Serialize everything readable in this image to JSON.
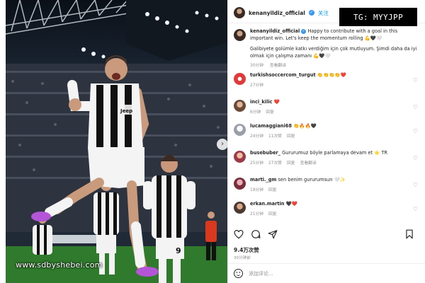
{
  "photo": {
    "watermark": "www.sdbyshebei.com",
    "player_numbers": [
      "9"
    ],
    "shirt_sponsor": "Jeep"
  },
  "badge": {
    "text": "TG: MYYJPP"
  },
  "post": {
    "username": "kenanyildiz_official",
    "follow_label": "关注",
    "icons": {
      "verified": "verified-badge-icon",
      "like": "heart-icon",
      "comment": "comment-icon",
      "share": "send-icon",
      "save": "bookmark-icon",
      "emoji": "emoji-icon"
    },
    "caption": {
      "username": "kenanyildiz_official",
      "text_en": "Happy to contribute with a goal in this important win. Let's keep the momentum rolling 💪🖤🤍",
      "text_tr": "Galibiyete golümle katkı verdiğim için çok mutluyum. Şimdi daha da iyi olmak için çalışma zamanı 💪🖤🤍",
      "time": "30分钟",
      "translate": "查看翻译"
    },
    "comments": [
      {
        "username": "turkishsoccercom_turgut",
        "text": "👏👏👏👏❤️",
        "time": "27分钟",
        "likes": "",
        "reply": ""
      },
      {
        "username": "inci_kilic",
        "text": "❤️",
        "time": "6分钟",
        "likes": "",
        "reply": "回复"
      },
      {
        "username": "lucamaggiani68",
        "text": "👏🔥🔥🖤",
        "time": "24分钟",
        "likes": "11次赞",
        "reply": "回复"
      },
      {
        "username": "busebuber_",
        "text": "Gururumuz böyle parlamaya devam et ⭐ TR",
        "time": "25分钟",
        "likes": "27次赞",
        "reply": "回复",
        "translate": "查看翻译"
      },
      {
        "username": "marti._gm",
        "text": "sen benim gururumsun 🤍✨",
        "time": "19分钟",
        "likes": "",
        "reply": "回复"
      },
      {
        "username": "erkan.martin",
        "text": "🖤❤️",
        "time": "21分钟",
        "likes": "",
        "reply": "回复"
      }
    ],
    "likes_count": "9.4万次赞",
    "post_date": "30分钟前",
    "comment_placeholder": "添加评论..."
  },
  "colors": {
    "accent": "#0095f6",
    "verified": "#3897f0",
    "text": "#262626",
    "muted": "#8e8e8e"
  }
}
